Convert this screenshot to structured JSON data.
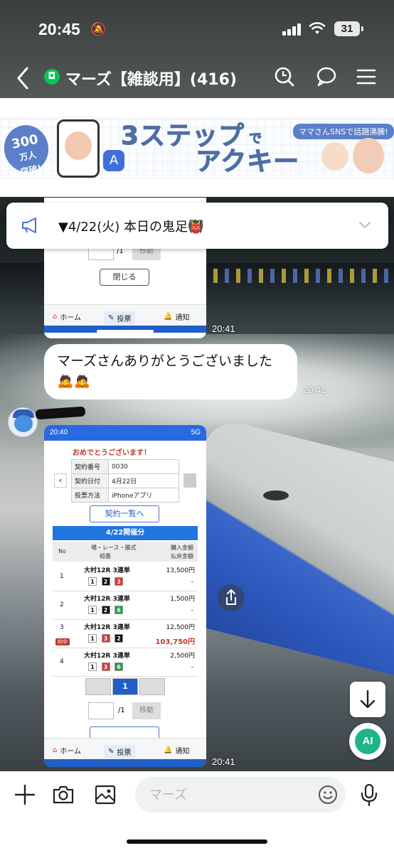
{
  "status_bar": {
    "time": "20:45",
    "battery": "31"
  },
  "header": {
    "title": "マーズ【雑談用】(416)"
  },
  "ad": {
    "badge_number": "300",
    "badge_unit": "万人",
    "badge_sub": "突破!",
    "headline_1": "3ステップ",
    "headline_de": "で",
    "headline_2": "アクキー",
    "tag": "ママさんSNSで話題沸騰!"
  },
  "announcement": {
    "text": "▼4/22(火) 本日の鬼足👹"
  },
  "screenshot1": {
    "page_suffix": "/1",
    "go_label": "移動",
    "close_label": "閉じる",
    "tab_home": "ホーム",
    "tab_vote": "投票",
    "tab_notify": "通知",
    "time": "20:41"
  },
  "message": {
    "text": "マーズさんありがとうございました🙇🙇",
    "time": "20:41"
  },
  "screenshot2": {
    "status_time": "20:40",
    "status_right": "5G",
    "congrats": "おめでとうございます！",
    "info": [
      {
        "label": "契約番号",
        "value": "0030"
      },
      {
        "label": "契約日付",
        "value": "4月22日"
      },
      {
        "label": "投票方法",
        "value": "iPhoneアプリ"
      }
    ],
    "list_button": "契約一覧へ",
    "section_title": "4/22開催分",
    "col_no": "No",
    "col_race": "場・レース・勝式",
    "col_combo": "組番",
    "col_buy": "購入金額",
    "col_pay": "払戻金額",
    "hit_label": "的中",
    "bets": [
      {
        "no": "1",
        "race": "大村12R 3連単",
        "combo": [
          "1",
          "2",
          "3"
        ],
        "amount": "13,500円",
        "payout": "-"
      },
      {
        "no": "2",
        "race": "大村12R 3連単",
        "combo": [
          "1",
          "2",
          "6"
        ],
        "amount": "1,500円",
        "payout": "-"
      },
      {
        "no": "3",
        "race": "大村12R 3連単",
        "combo": [
          "1",
          "3",
          "2"
        ],
        "amount": "12,500円",
        "payout": "103,750円"
      },
      {
        "no": "4",
        "race": "大村12R 3連単",
        "combo": [
          "1",
          "3",
          "6"
        ],
        "amount": "2,500円",
        "payout": "-"
      }
    ],
    "page_current": "1",
    "page_suffix": "/1",
    "go_label": "移動",
    "tab_home": "ホーム",
    "tab_vote": "投票",
    "tab_notify": "通知",
    "time": "20:41"
  },
  "ai_button": "AI",
  "input": {
    "placeholder": "マーズ"
  }
}
